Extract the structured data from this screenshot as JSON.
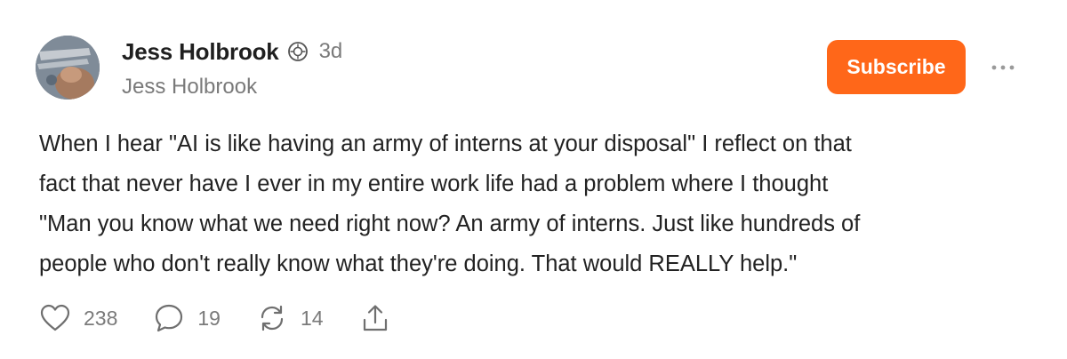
{
  "post": {
    "author": {
      "name": "Jess Holbrook",
      "handle": "Jess Holbrook",
      "timestamp": "3d",
      "verified_icon": "badge-check-icon"
    },
    "subscribe_label": "Subscribe",
    "more_icon": "ellipsis-icon",
    "text": "When I hear \"AI is like having an army of interns at your disposal\" I reflect on that\nfact that never have I ever in my entire work life had a problem where I thought\n\"Man you know what we need right now? An army of interns. Just like hundreds of\npeople who don't really know what they're doing. That would REALLY help.\"",
    "actions": {
      "likes": "238",
      "comments": "19",
      "restacks": "14"
    },
    "colors": {
      "accent": "#ff6719",
      "muted_text": "#7a7a7a",
      "body_text": "#222222"
    }
  }
}
